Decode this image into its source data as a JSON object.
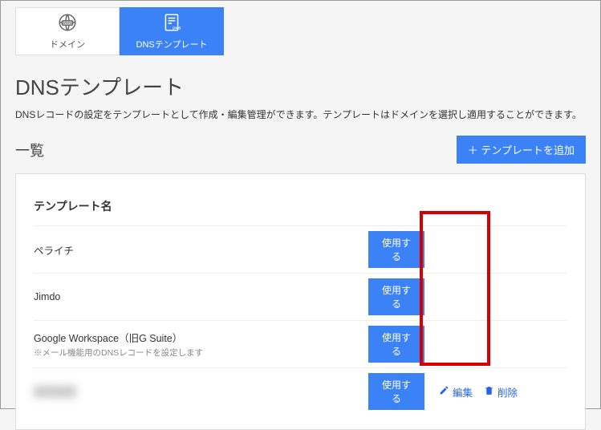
{
  "tabs": {
    "domain": {
      "label": "ドメイン"
    },
    "dns_template": {
      "label": "DNSテンプレート"
    }
  },
  "page": {
    "title": "DNSテンプレート",
    "description": "DNSレコードの設定をテンプレートとして作成・編集管理ができます。テンプレートはドメインを選択し適用することができます。"
  },
  "list": {
    "title": "一覧",
    "add_button": "＋ テンプレートを追加",
    "column_name": "テンプレート名",
    "use_label": "使用する",
    "edit_label": "編集",
    "delete_label": "削除",
    "rows": [
      {
        "name": "ペライチ",
        "note": ""
      },
      {
        "name": "Jimdo",
        "note": ""
      },
      {
        "name": "Google Workspace（旧G Suite）",
        "note": "※メール機能用のDNSレコードを設定します"
      },
      {
        "name": "██████",
        "note": "",
        "editable": true
      }
    ]
  }
}
